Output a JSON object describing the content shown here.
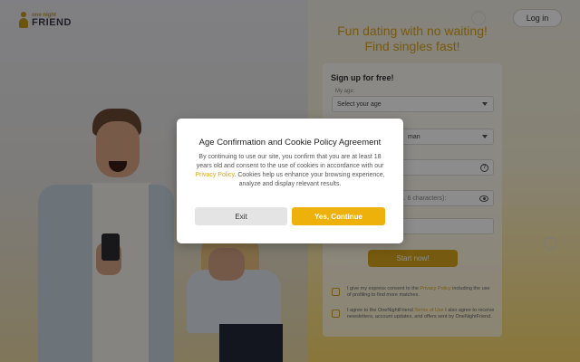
{
  "header": {
    "logo_top": "one night",
    "logo_bottom": "FRIEND",
    "login_label": "Log in"
  },
  "hero": {
    "headline": "Fun dating with no waiting! Find singles fast!"
  },
  "signup_form": {
    "title": "Sign up for free!",
    "age_label": "My age:",
    "age_placeholder": "Select your age",
    "gender_value": "man",
    "password_placeholder": "(min. 6 characters):",
    "start_label": "Start now!",
    "consent_1_prefix": "I give my express consent to the",
    "consent_1_link": "Privacy Policy",
    "consent_1_suffix": "including the use of profiling to find more matches.",
    "consent_2_prefix": "I agree to the OneNightFriend",
    "consent_2_link": "Terms of Use",
    "consent_2_suffix": "I also agree to receive newsletters, account updates, and offers sent by OneNightFriend."
  },
  "modal": {
    "title": "Age Confirmation and Cookie Policy Agreement",
    "body_part1": "By continuing to use our site, you confirm that you are at least 18 years old and consent to the use of cookies in accordance with our",
    "body_link": "Privacy Policy",
    "body_part2": ". Cookies help us enhance your browsing experience, analyze and display relevant results.",
    "exit_label": "Exit",
    "yes_label": "Yes, Continue"
  },
  "colors": {
    "accent": "#eeb00a",
    "link": "#d9a418"
  }
}
